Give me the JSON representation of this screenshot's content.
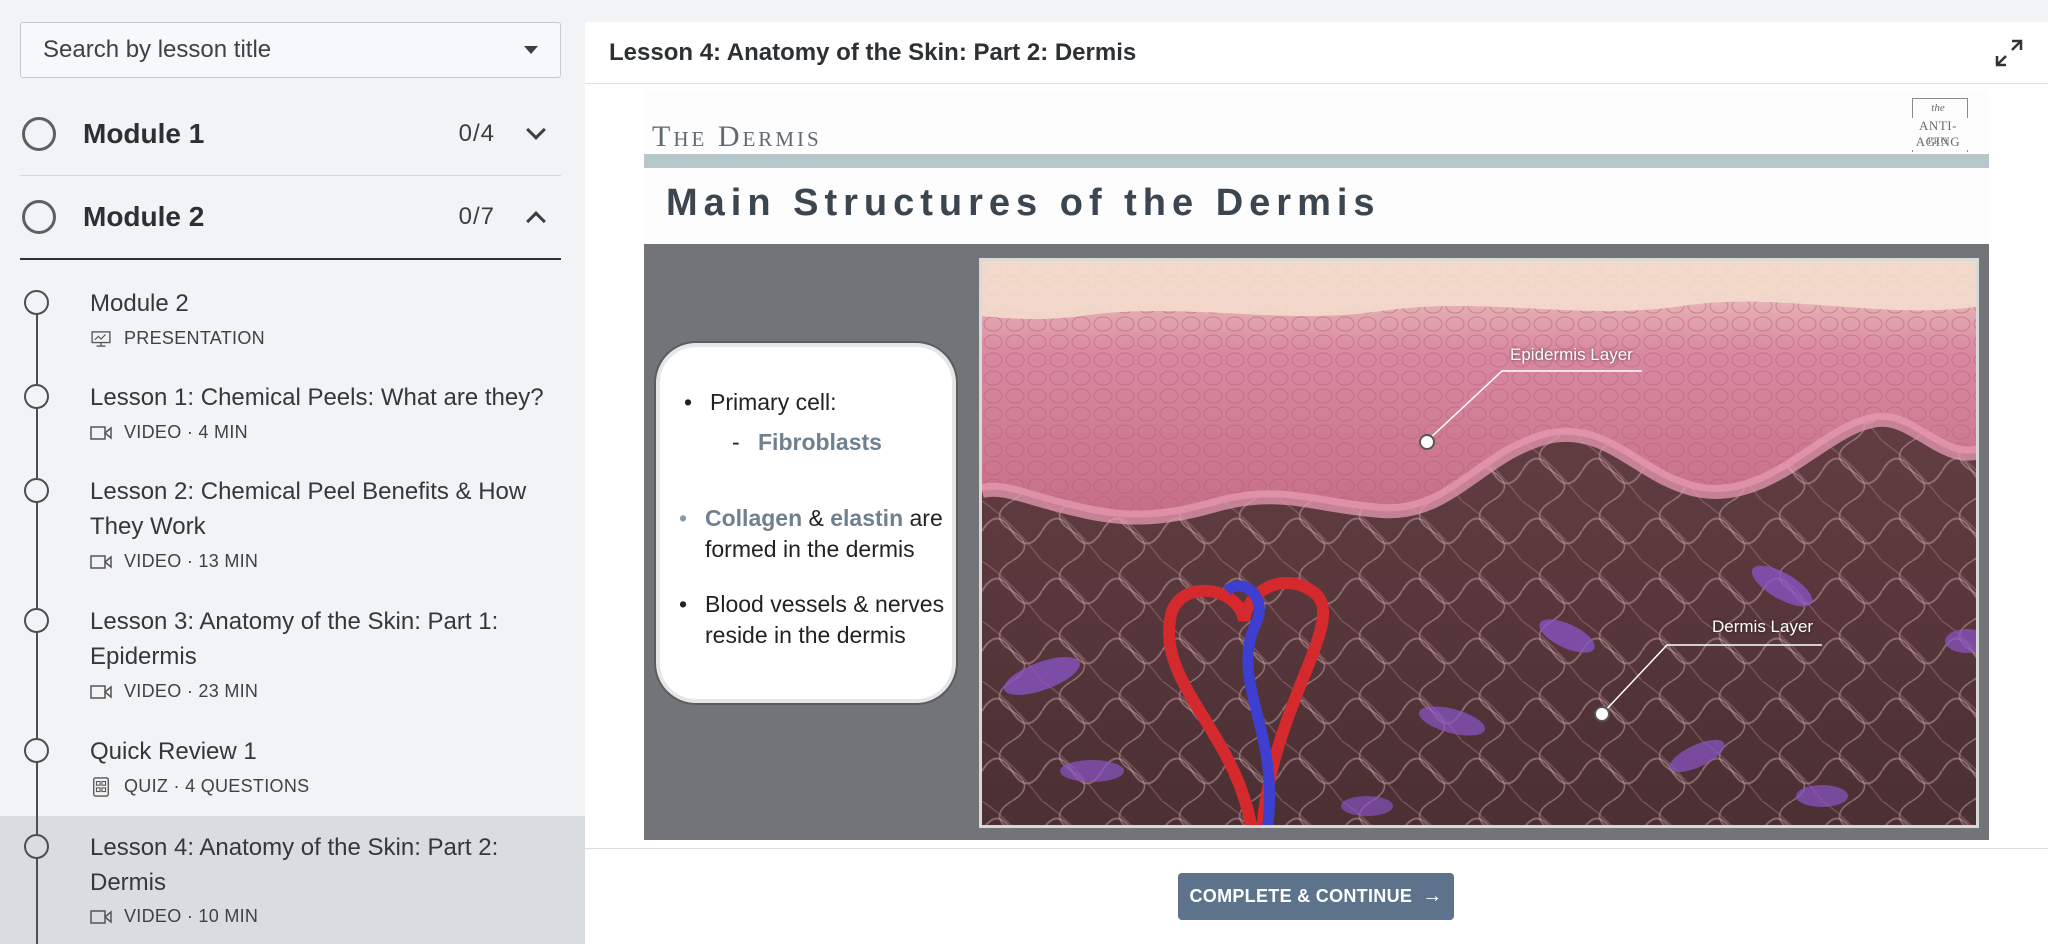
{
  "search": {
    "placeholder": "Search by lesson title"
  },
  "modules": [
    {
      "title": "Module 1",
      "progress": "0/4",
      "expanded": false
    },
    {
      "title": "Module 2",
      "progress": "0/7",
      "expanded": true
    }
  ],
  "lessons": [
    {
      "title": "Module 2",
      "meta": "PRESENTATION",
      "icon": "presentation-icon"
    },
    {
      "title": "Lesson 1: Chemical Peels: What are they?",
      "meta": "VIDEO · 4 MIN",
      "icon": "video-icon"
    },
    {
      "title": "Lesson 2: Chemical Peel Benefits & How They Work",
      "meta": "VIDEO · 13 MIN",
      "icon": "video-icon"
    },
    {
      "title": "Lesson 3: Anatomy of the Skin: Part 1: Epidermis",
      "meta": "VIDEO · 23 MIN",
      "icon": "video-icon"
    },
    {
      "title": "Quick Review 1",
      "meta": "QUIZ · 4 QUESTIONS",
      "icon": "quiz-icon"
    },
    {
      "title": "Lesson 4: Anatomy of the Skin: Part 2: Dermis",
      "meta": "VIDEO · 10 MIN",
      "icon": "video-icon",
      "active": true
    }
  ],
  "panel": {
    "title": "Lesson 4: Anatomy of the Skin: Part 2: Dermis"
  },
  "slide": {
    "kicker": "The Dermis",
    "logo": {
      "small": "the",
      "main": "ANTI-AGING",
      "sub": "PRO"
    },
    "title": "Main Structures of the Dermis",
    "bullets": {
      "primary": "Primary cell:",
      "fibroblasts": "Fibroblasts",
      "collagen": "Collagen",
      "amp": "&",
      "elastin": "elastin",
      "are": "are",
      "formed": "formed in the dermis",
      "blood1": "Blood vessels & nerves",
      "blood2": "reside in the dermis"
    },
    "labels": {
      "epidermis": "Epidermis Layer",
      "dermis": "Dermis Layer"
    }
  },
  "footer": {
    "cta": "COMPLETE & CONTINUE"
  },
  "colors": {
    "accent": "#5c738b",
    "slide_bar": "#b6c8cc"
  }
}
